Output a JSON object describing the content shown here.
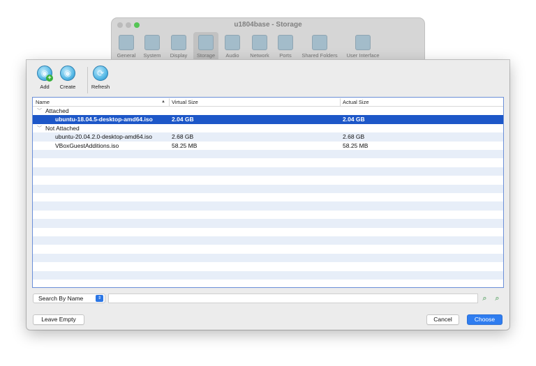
{
  "background_window": {
    "title": "u1804base - Storage",
    "tabs": [
      {
        "label": "General",
        "icon": "general-icon"
      },
      {
        "label": "System",
        "icon": "system-icon"
      },
      {
        "label": "Display",
        "icon": "display-icon"
      },
      {
        "label": "Storage",
        "icon": "storage-icon"
      },
      {
        "label": "Audio",
        "icon": "audio-icon"
      },
      {
        "label": "Network",
        "icon": "network-icon"
      },
      {
        "label": "Ports",
        "icon": "ports-icon"
      },
      {
        "label": "Shared Folders",
        "icon": "shared-folders-icon"
      },
      {
        "label": "User Interface",
        "icon": "user-interface-icon"
      }
    ]
  },
  "toolbar": {
    "add_label": "Add",
    "create_label": "Create",
    "refresh_label": "Refresh"
  },
  "table": {
    "columns": [
      "Name",
      "Virtual Size",
      "Actual Size"
    ],
    "groups": [
      {
        "label": "Attached"
      },
      {
        "label": "Not Attached"
      }
    ],
    "rows": [
      {
        "name": "ubuntu-18.04.5-desktop-amd64.iso",
        "virtual": "2.04 GB",
        "actual": "2.04 GB"
      },
      {
        "name": "ubuntu-20.04.2.0-desktop-amd64.iso",
        "virtual": "2.68 GB",
        "actual": "2.68 GB"
      },
      {
        "name": "VBoxGuestAdditions.iso",
        "virtual": "58.25 MB",
        "actual": "58.25 MB"
      }
    ]
  },
  "search": {
    "mode": "Search By Name",
    "query": ""
  },
  "buttons": {
    "leave_empty": "Leave Empty",
    "cancel": "Cancel",
    "choose": "Choose"
  },
  "colors": {
    "selection": "#1d57c8",
    "accent": "#2f7df0",
    "alt_row": "#e7eef8"
  }
}
